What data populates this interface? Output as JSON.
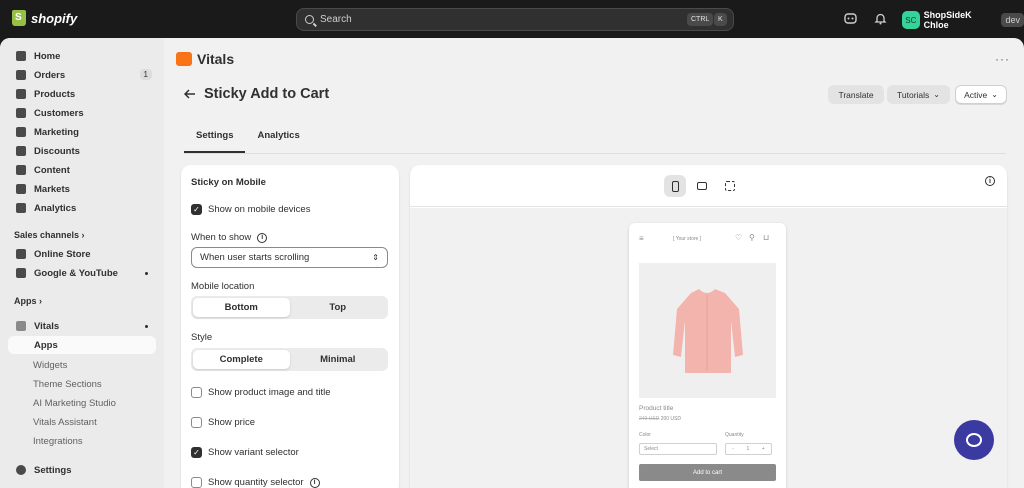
{
  "topbar": {
    "brand": "shopify",
    "search_placeholder": "Search",
    "kbd_ctrl": "CTRL",
    "kbd_k": "K",
    "store_initials": "SC",
    "store_name": "ShopSideK Chloe",
    "env_tag": "dev"
  },
  "sidebar": {
    "items": [
      {
        "label": "Home",
        "icon": "home-icon"
      },
      {
        "label": "Orders",
        "icon": "orders-icon",
        "badge": "1"
      },
      {
        "label": "Products",
        "icon": "tag-icon"
      },
      {
        "label": "Customers",
        "icon": "person-icon"
      },
      {
        "label": "Marketing",
        "icon": "target-icon"
      },
      {
        "label": "Discounts",
        "icon": "discount-icon"
      },
      {
        "label": "Content",
        "icon": "content-icon"
      },
      {
        "label": "Markets",
        "icon": "globe-icon"
      },
      {
        "label": "Analytics",
        "icon": "chart-icon"
      }
    ],
    "sales_channels_label": "Sales channels ›",
    "channels": [
      {
        "label": "Online Store",
        "icon": "store-icon"
      },
      {
        "label": "Google & YouTube",
        "icon": "google-icon"
      }
    ],
    "apps_label": "Apps ›",
    "vitals_label": "Vitals",
    "vitals_sub": [
      "Apps",
      "Widgets",
      "Theme Sections",
      "AI Marketing Studio",
      "Vitals Assistant",
      "Integrations"
    ],
    "settings_label": "Settings"
  },
  "app": {
    "name": "Vitals",
    "page_title": "Sticky Add to Cart",
    "translate": "Translate",
    "tutorials": "Tutorials",
    "status": "Active",
    "tabs": [
      "Settings",
      "Analytics"
    ]
  },
  "settings": {
    "card_title": "Sticky on Mobile",
    "show_mobile": "Show on mobile devices",
    "when_to_show_label": "When to show",
    "when_to_show_value": "When user starts scrolling",
    "mobile_location_label": "Mobile location",
    "location_options": [
      "Bottom",
      "Top"
    ],
    "style_label": "Style",
    "style_options": [
      "Complete",
      "Minimal"
    ],
    "show_image_title": "Show product image and title",
    "show_price": "Show price",
    "show_variant": "Show variant selector",
    "show_quantity": "Show quantity selector"
  },
  "preview": {
    "store_name": "[ Your store ]",
    "product_title": "Product title",
    "old_price": "240 USD",
    "price": "200 USD",
    "color_label": "Color",
    "select_placeholder": "Select",
    "quantity_label": "Quantity",
    "qty_value": "1",
    "add_to_cart": "Add to cart"
  }
}
